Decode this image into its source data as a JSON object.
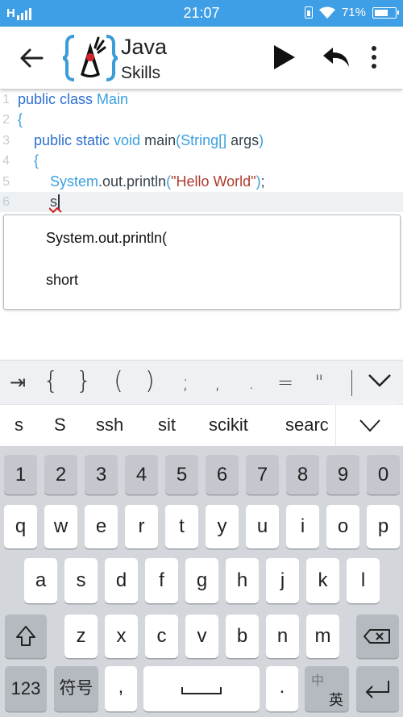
{
  "status_bar": {
    "signal": "H",
    "time": "21:07",
    "battery": "71%",
    "battery_level": 0.71
  },
  "app_bar": {
    "back_icon": "arrow-left-icon",
    "logo_icon": "java-duke-logo",
    "title_line1": "Java",
    "title_line2": "Skills",
    "run_icon": "play-icon",
    "undo_icon": "undo-icon",
    "menu_icon": "more-vert-icon"
  },
  "editor": {
    "lines": [
      {
        "num": "1",
        "tokens": [
          [
            "kw",
            "public class "
          ],
          [
            "tp",
            "Main"
          ]
        ]
      },
      {
        "num": "2",
        "tokens": [
          [
            "tp",
            "{"
          ]
        ]
      },
      {
        "num": "3",
        "tokens": [
          [
            "kw",
            "public static "
          ],
          [
            "tp",
            "void "
          ],
          [
            "id",
            "main"
          ],
          [
            "tp",
            "(String[] "
          ],
          [
            "id",
            "args"
          ],
          [
            "tp",
            ")"
          ]
        ]
      },
      {
        "num": "4",
        "tokens": [
          [
            "tp",
            "{"
          ]
        ]
      },
      {
        "num": "5",
        "tokens": [
          [
            "tp",
            "System"
          ],
          [
            "id",
            ".out.println"
          ],
          [
            "tp",
            "("
          ],
          [
            "str",
            "\"Hello World\""
          ],
          [
            "tp",
            ")"
          ],
          [
            "id",
            ";"
          ]
        ]
      },
      {
        "num": "6",
        "tokens": [
          [
            "id",
            "s"
          ]
        ]
      }
    ],
    "autocomplete": [
      "System.out.println(",
      "short"
    ]
  },
  "symbol_bar": {
    "symbols": [
      "⇥",
      "{",
      "}",
      "(",
      ")",
      ";",
      ",",
      ".",
      "=",
      "\""
    ],
    "collapse_icon": "chevron-down-icon"
  },
  "suggestions": {
    "words": [
      "s",
      "S",
      "ssh",
      "sit",
      "scikit",
      "searc"
    ],
    "expand_icon": "chevron-down-icon"
  },
  "keyboard": {
    "row_numbers": [
      "1",
      "2",
      "3",
      "4",
      "5",
      "6",
      "7",
      "8",
      "9",
      "0"
    ],
    "row1": [
      "q",
      "w",
      "e",
      "r",
      "t",
      "y",
      "u",
      "i",
      "o",
      "p"
    ],
    "row2": [
      "a",
      "s",
      "d",
      "f",
      "g",
      "h",
      "j",
      "k",
      "l"
    ],
    "row3": [
      "z",
      "x",
      "c",
      "v",
      "b",
      "n",
      "m"
    ],
    "shift_icon": "shift-icon",
    "backspace_icon": "backspace-icon",
    "key_123": "123",
    "key_symbols": "符号",
    "key_comma": ",",
    "space_icon": "space-bar-icon",
    "key_period": ".",
    "lang_top": "中",
    "lang_bottom": "英",
    "enter_icon": "enter-icon"
  },
  "colors": {
    "status_bar": "#3f9fe6",
    "keyword": "#2d6fd0",
    "type": "#3aa0e0",
    "string": "#b03a2e",
    "error_squiggle": "#d21f1f"
  }
}
